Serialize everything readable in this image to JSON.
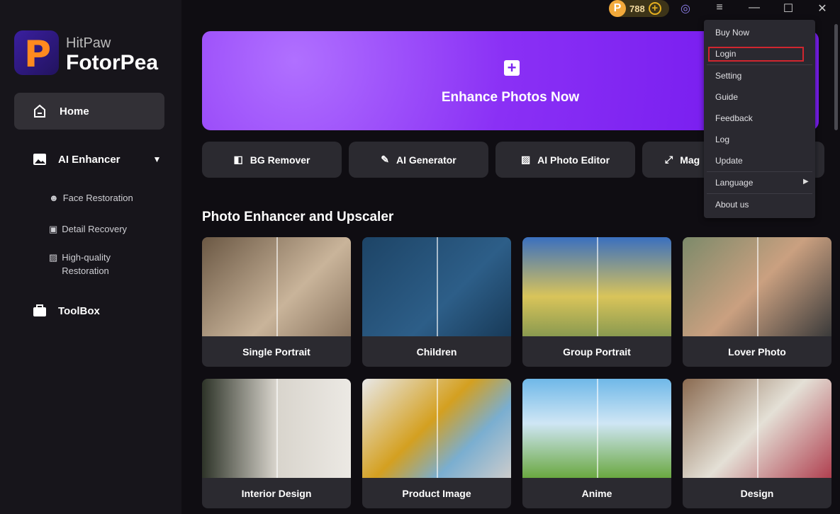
{
  "brand": {
    "line1": "HitPaw",
    "line2": "FotorPea"
  },
  "sidebar": {
    "home": "Home",
    "ai_enhancer": "AI Enhancer",
    "subs": [
      "Face Restoration",
      "Detail Recovery",
      "High-quality Restoration"
    ],
    "toolbox": "ToolBox"
  },
  "topbar": {
    "coins": "788"
  },
  "banner": {
    "title": "Enhance Photos Now"
  },
  "tools": [
    "BG Remover",
    "AI Generator",
    "AI Photo Editor",
    "Mag"
  ],
  "section_title": "Photo Enhancer and Upscaler",
  "cards": [
    "Single Portrait",
    "Children",
    "Group Portrait",
    "Lover Photo",
    "Interior Design",
    "Product Image",
    "Anime",
    "Design"
  ],
  "menu": {
    "items": [
      "Buy Now",
      "Login",
      "Setting",
      "Guide",
      "Feedback",
      "Log",
      "Update",
      "Language",
      "About us"
    ],
    "highlighted": "Login"
  },
  "colors": {
    "accent": "#8a30f5",
    "highlight_border": "#d0262f",
    "coin": "#f2a93b"
  }
}
